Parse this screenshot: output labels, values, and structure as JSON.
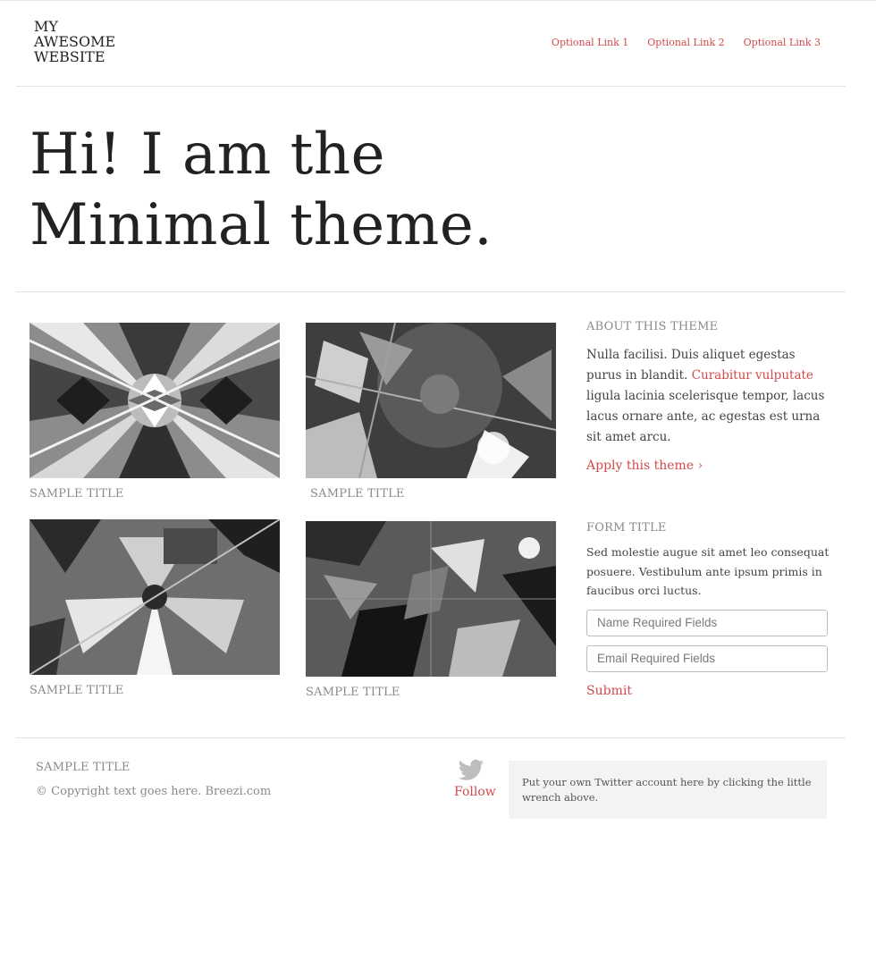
{
  "header": {
    "logo_lines": [
      "MY",
      "AWESOME",
      "WEBSITE"
    ],
    "nav": [
      "Optional Link 1",
      "Optional Link 2",
      "Optional Link 3"
    ]
  },
  "hero": {
    "line1": "Hi! I am the",
    "line2": "Minimal theme."
  },
  "gallery": [
    {
      "caption": "SAMPLE TITLE"
    },
    {
      "caption": "SAMPLE TITLE"
    },
    {
      "caption": "SAMPLE TITLE"
    },
    {
      "caption": "SAMPLE TITLE"
    }
  ],
  "about": {
    "title": "ABOUT THIS THEME",
    "text_before": "Nulla facilisi. Duis aliquet egestas purus in blandit.",
    "link": "Curabitur vulputate",
    "text_after": "ligula lacinia scelerisque tempor, lacus lacus ornare ante, ac egestas est urna sit amet arcu.",
    "apply": "Apply this theme ›"
  },
  "form": {
    "title": "FORM TITLE",
    "text": "Sed molestie augue sit amet leo consequat posuere. Vestibulum ante ipsum primis in faucibus orci luctus.",
    "name_placeholder": "Name Required Fields",
    "email_placeholder": "Email Required Fields",
    "submit": "Submit"
  },
  "footer": {
    "title": "SAMPLE TITLE",
    "copyright": "© Copyright text goes here. Breezi.com",
    "follow": "Follow",
    "tweet": "Put your own Twitter account here by clicking the little wrench above."
  },
  "colors": {
    "accent": "#d34a4a",
    "text": "#222222",
    "muted": "#8a8a8a",
    "divider": "#e4e4e4"
  },
  "icons": {
    "twitter": "twitter-bird-icon"
  }
}
